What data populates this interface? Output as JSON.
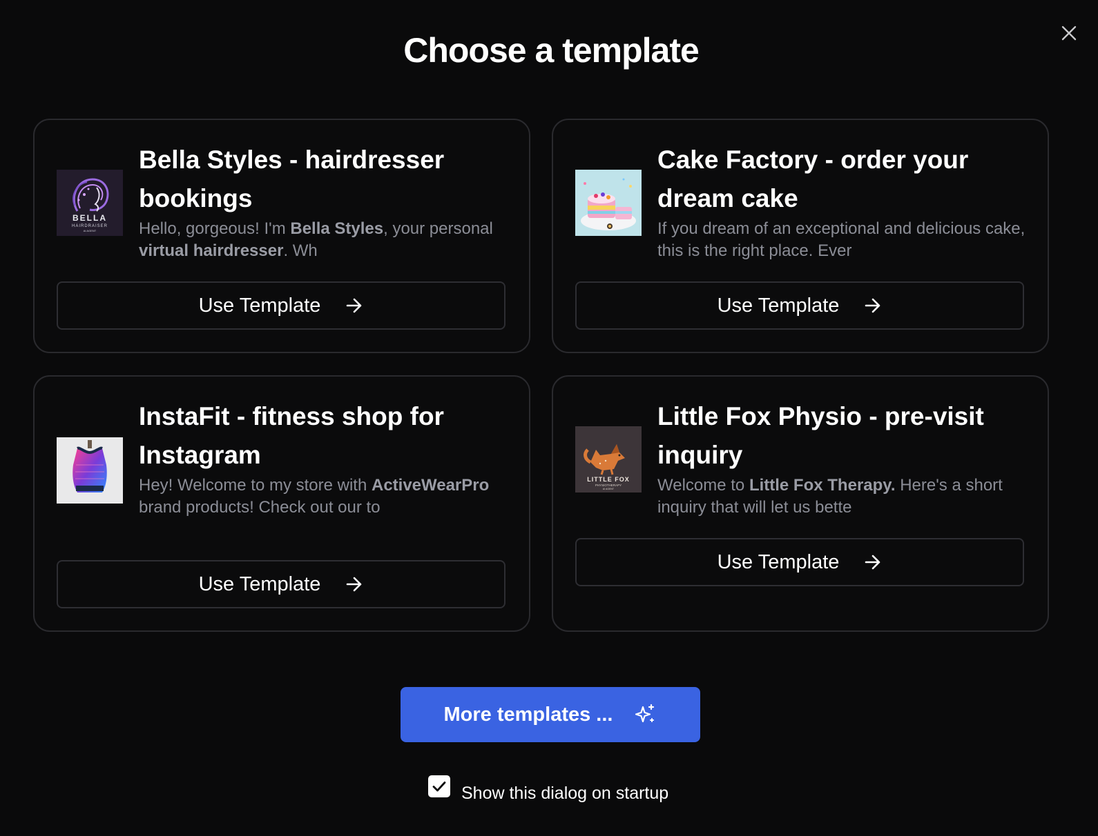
{
  "dialog": {
    "title": "Choose a template",
    "close_icon": "close-icon"
  },
  "templates": [
    {
      "title": "Bella Styles - hairdresser bookings",
      "desc_parts": [
        "Hello, gorgeous! I'm ",
        "Bella Styles",
        ", your personal ",
        "virtual hairdresser",
        ". Wh"
      ],
      "thumb_text_1": "BELLA",
      "thumb_text_2": "HAIRDRAISER",
      "thumb_text_3": "AI AGENT",
      "button_label": "Use Template",
      "button_icon": "arrow-right-icon"
    },
    {
      "title": "Cake Factory - order your dream cake",
      "desc_parts": [
        "If you dream of an exceptional and delicious cake, this is the right place. Ever"
      ],
      "button_label": "Use Template",
      "button_icon": "arrow-right-icon"
    },
    {
      "title": "InstaFit - fitness shop for Instagram",
      "desc_parts": [
        "Hey! Welcome to my store with ",
        "ActiveWearPro",
        " brand products! Check out our to"
      ],
      "button_label": "Use Template",
      "button_icon": "arrow-right-icon"
    },
    {
      "title": "Little Fox Physio - pre-visit inquiry",
      "desc_parts": [
        "Welcome to ",
        "Little Fox Therapy.",
        " Here's a short inquiry that will let us bette"
      ],
      "thumb_text_1": "LITTLE FOX",
      "thumb_text_2": "PHYSIOTHERAPY",
      "thumb_text_3": "AI AGENT",
      "button_label": "Use Template",
      "button_icon": "arrow-right-icon"
    }
  ],
  "footer": {
    "more_label": "More templates ...",
    "more_icon": "sparkles-icon",
    "startup_label": "Show this dialog on startup",
    "startup_checked": true
  },
  "colors": {
    "background": "#0a0a0b",
    "card_border": "#2a2a2e",
    "accent": "#3a63e2",
    "muted_text": "#8b8d96"
  }
}
